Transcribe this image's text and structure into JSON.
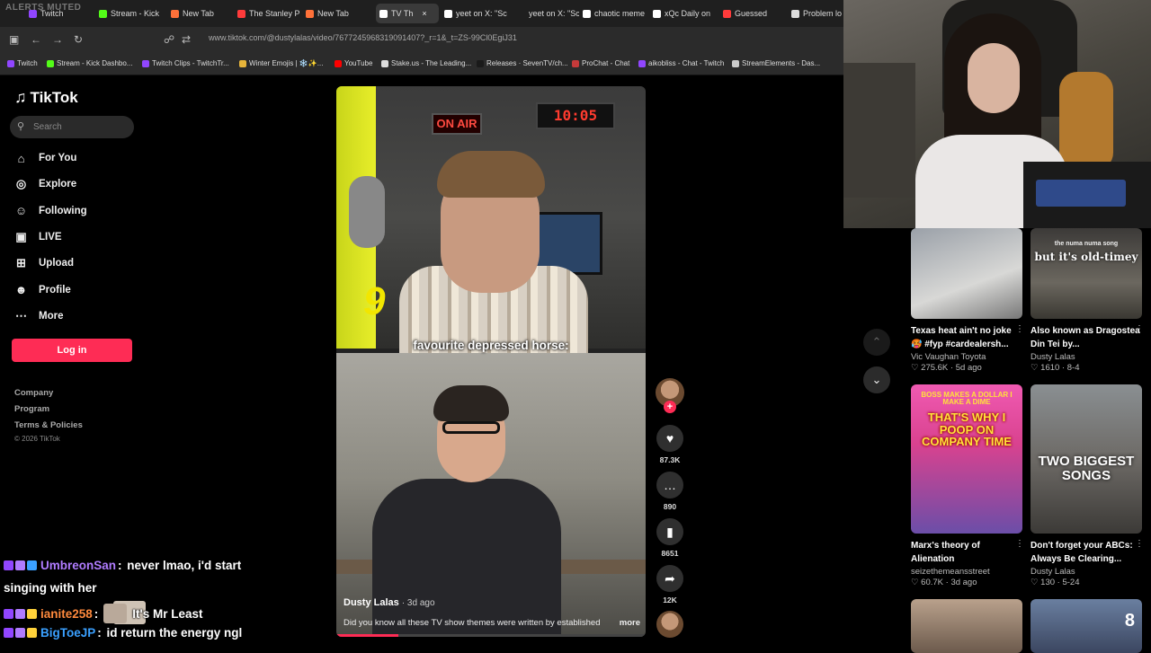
{
  "browser": {
    "alerts_label": "ALERTS MUTED",
    "tabs": [
      {
        "label": "Twitch",
        "color": "#9146ff"
      },
      {
        "label": "Stream - Kick",
        "color": "#53fc18"
      },
      {
        "label": "New Tab",
        "color": "#ff7139"
      },
      {
        "label": "The Stanley P",
        "color": "#ff3b3b"
      },
      {
        "label": "New Tab",
        "color": "#ff7139"
      },
      {
        "label": "TV Th",
        "color": "#ffffff"
      },
      {
        "label": "yeet on X: \"Sc",
        "color": "#ffffff"
      },
      {
        "label": "yeet on X: \"Sc",
        "color": "#ffffff"
      },
      {
        "label": "chaotic meme",
        "color": "#ffffff"
      },
      {
        "label": "xQc Daily on",
        "color": "#ffffff"
      },
      {
        "label": "Guessed",
        "color": "#ff3b3b"
      },
      {
        "label": "Problem lo",
        "color": "#dddddd"
      }
    ],
    "url": "www.tiktok.com/@dustylalas/video/7677245968319091407?_r=1&_t=ZS-99Cl0EgiJ31",
    "bookmarks": [
      {
        "label": "Twitch",
        "color": "#9146ff"
      },
      {
        "label": "Stream - Kick Dashbo...",
        "color": "#53fc18"
      },
      {
        "label": "Twitch Clips - TwitchTr...",
        "color": "#9146ff"
      },
      {
        "label": "Winter Emojis | ❄️✨...",
        "color": "#e8b53a"
      },
      {
        "label": "YouTube",
        "color": "#ff0000"
      },
      {
        "label": "Stake.us - The Leading...",
        "color": "#dddddd"
      },
      {
        "label": "Releases · SevenTV/ch...",
        "color": "#1a1a1a"
      },
      {
        "label": "ProChat - Chat",
        "color": "#c53a3a"
      },
      {
        "label": "aikobliss - Chat - Twitch",
        "color": "#9146ff"
      },
      {
        "label": "StreamElements - Das...",
        "color": "#cccccc"
      }
    ]
  },
  "tiktok": {
    "logo": "TikTok",
    "search_placeholder": "Search",
    "nav": [
      {
        "label": "For You",
        "icon": "home-icon",
        "glyph": "⌂"
      },
      {
        "label": "Explore",
        "icon": "compass-icon",
        "glyph": "◎"
      },
      {
        "label": "Following",
        "icon": "user-icon",
        "glyph": "☺"
      },
      {
        "label": "LIVE",
        "icon": "live-tv-icon",
        "glyph": "▣"
      },
      {
        "label": "Upload",
        "icon": "plus-square-icon",
        "glyph": "⊞"
      },
      {
        "label": "Profile",
        "icon": "profile-icon",
        "glyph": "☻"
      },
      {
        "label": "More",
        "icon": "more-dots-icon",
        "glyph": "⋯"
      }
    ],
    "login_label": "Log in",
    "footer_links": [
      "Company",
      "Program",
      "Terms & Policies"
    ],
    "copyright": "© 2026 TikTok"
  },
  "video": {
    "clock_text": "10:05",
    "on_air_text": "ON AIR",
    "overlay_number": "9",
    "caption": "favourite depressed horse:",
    "author": "Dusty Lalas",
    "age": "· 3d ago",
    "description": "Did you know all these TV show themes were written by established",
    "more_label": "more",
    "progress_fraction": 0.2,
    "actions": [
      {
        "name": "like",
        "glyph": "♥",
        "count": "87.3K"
      },
      {
        "name": "comment",
        "glyph": "…",
        "count": "890"
      },
      {
        "name": "bookmark",
        "glyph": "▮",
        "count": "8651"
      },
      {
        "name": "share",
        "glyph": "➦",
        "count": "12K"
      }
    ],
    "follow_plus": "+"
  },
  "recommendations": [
    {
      "title": "Texas heat ain't no joke 🥵 #fyp #cardealersh...",
      "author": "Vic Vaughan Toyota",
      "likes": "275.6K",
      "age": "5d ago",
      "overlay": ""
    },
    {
      "title": "Also known as Dragostea Din Tei by...",
      "author": "Dusty Lalas",
      "likes": "1610",
      "age": "8-4",
      "overlay": "but it's old-timey",
      "overlay_small": "the numa numa song"
    },
    {
      "title": "Marx's theory of Alienation",
      "author": "seizethemeansstreet",
      "likes": "60.7K",
      "age": "3d ago",
      "overlay": "THAT'S WHY I POOP ON COMPANY TIME",
      "overlay_small": "BOSS MAKES A DOLLAR I MAKE A DIME"
    },
    {
      "title": "Don't forget your ABCs: Always Be Clearing...",
      "author": "Dusty Lalas",
      "likes": "130",
      "age": "5-24",
      "overlay": "TWO BIGGEST SONGS"
    },
    {
      "title": "",
      "author": "",
      "likes": "",
      "age": "",
      "overlay": ""
    },
    {
      "title": "",
      "author": "",
      "likes": "",
      "age": "",
      "overlay": "8"
    }
  ],
  "chat": [
    {
      "user": "UmbreonSan",
      "user_color": "#b07cff",
      "message": " never lmao, i'd start"
    },
    {
      "user": "",
      "user_color": "#ffffff",
      "message": "singing with her"
    },
    {
      "user": "ianite258",
      "user_color": "#ff8a3d",
      "message": "It's Mr Least"
    },
    {
      "user": "BigToeJP",
      "user_color": "#3aa0ff",
      "message": " id return the energy ngl"
    }
  ]
}
